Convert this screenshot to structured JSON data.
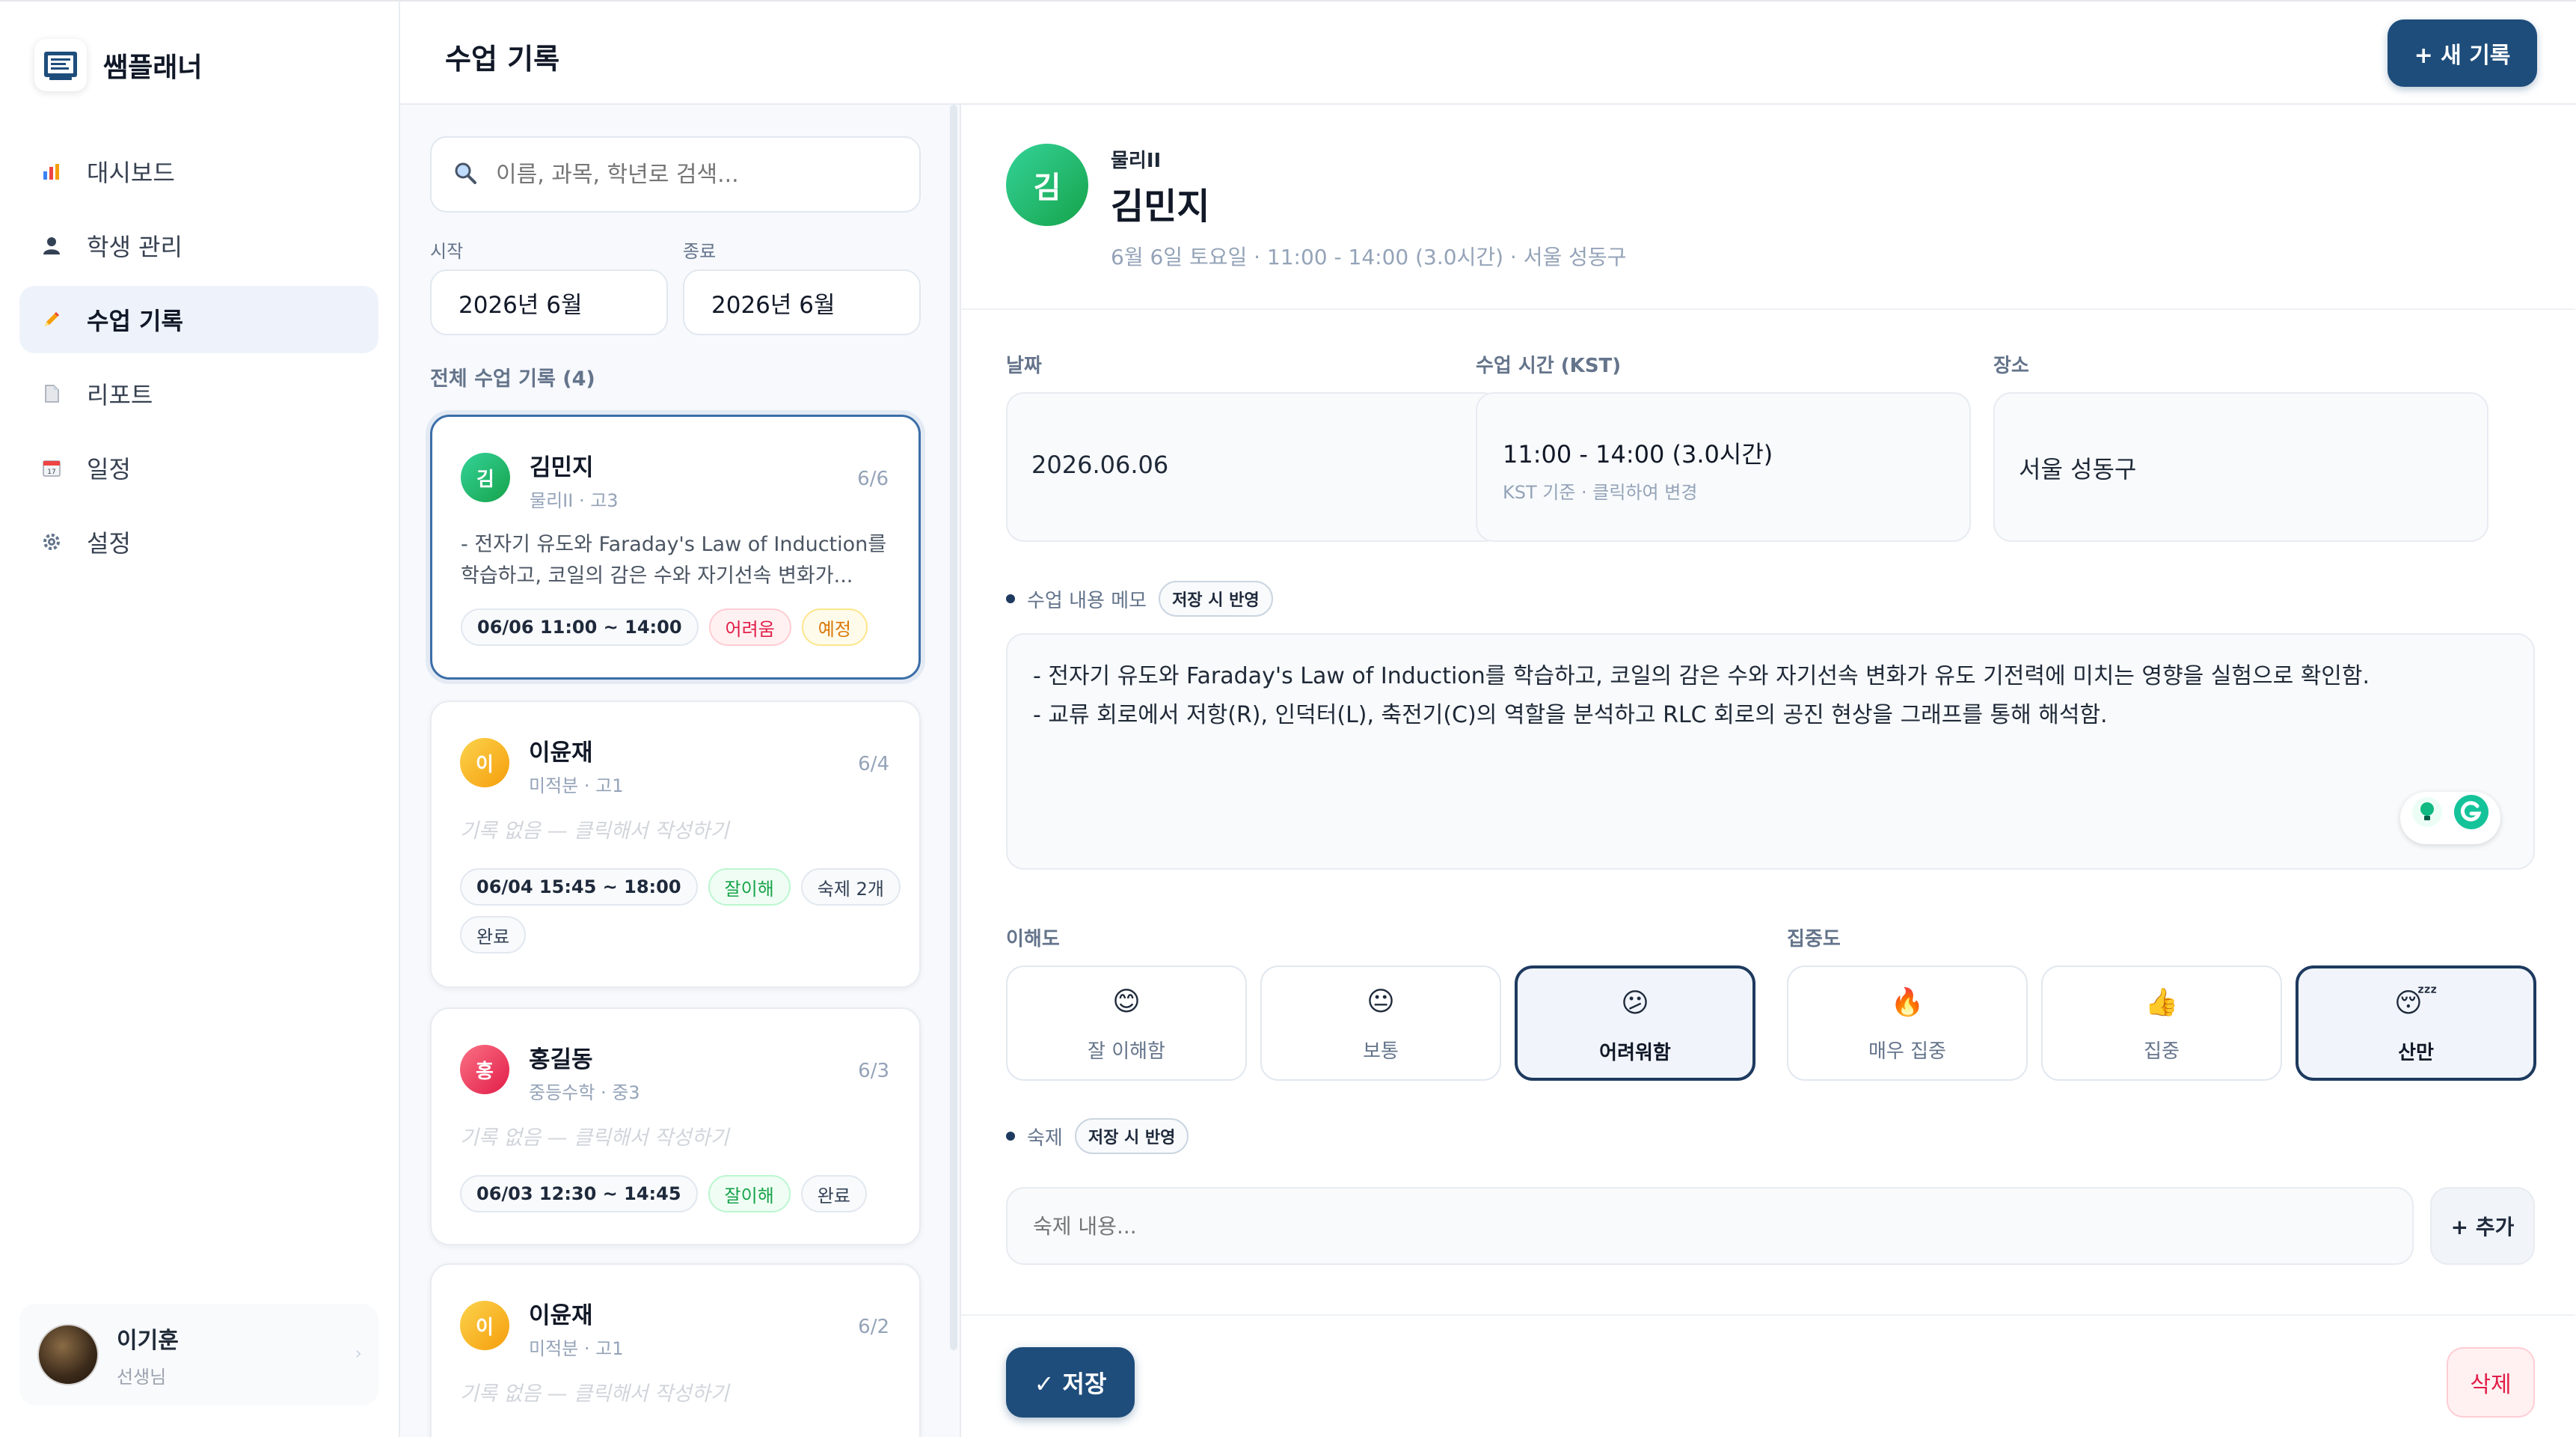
{
  "sidebar": {
    "brand": "쌤플래너",
    "items": [
      {
        "label": "대시보드",
        "icon": "chart-icon"
      },
      {
        "label": "학생 관리",
        "icon": "user-icon"
      },
      {
        "label": "수업 기록",
        "icon": "pencil-icon"
      },
      {
        "label": "리포트",
        "icon": "document-icon"
      },
      {
        "label": "일정",
        "icon": "calendar-icon"
      },
      {
        "label": "설정",
        "icon": "gear-icon"
      }
    ],
    "active_item": "수업 기록",
    "user": {
      "name": "이기훈",
      "role": "선생님"
    }
  },
  "header": {
    "title": "수업 기록",
    "new_button": "+ 새 기록"
  },
  "list": {
    "search_placeholder": "이름, 과목, 학년로 검색...",
    "start_label": "시작",
    "start_value": "2026년 6월",
    "end_label": "종료",
    "end_value": "2026년 6월",
    "count_label": "전체 수업 기록 (4)",
    "cards": [
      {
        "initial": "김",
        "avatar_color": "#22c55e",
        "name": "김민지",
        "sub": "물리II · 고3",
        "date": "6/6",
        "body": "- 전자기 유도와 Faraday's Law of Induction를 학습하고, 코일의 감은 수와 자기선속 변화가...",
        "chips": [
          {
            "text": "06/06 11:00 ~ 14:00",
            "kind": "time"
          },
          {
            "text": "어려움",
            "kind": "hard"
          },
          {
            "text": "예정",
            "kind": "plan"
          }
        ]
      },
      {
        "initial": "이",
        "avatar_color": "#f59e0b",
        "name": "이윤재",
        "sub": "미적분 · 고1",
        "date": "6/4",
        "empty": "기록 없음 — 클릭해서 작성하기",
        "chips": [
          {
            "text": "06/04 15:45 ~ 18:00",
            "kind": "time"
          },
          {
            "text": "잘이해",
            "kind": "good"
          },
          {
            "text": "숙제 2개",
            "kind": "plain"
          },
          {
            "text": "완료",
            "kind": "plain"
          }
        ]
      },
      {
        "initial": "홍",
        "avatar_color": "#f43f5e",
        "name": "홍길동",
        "sub": "중등수학 · 중3",
        "date": "6/3",
        "empty": "기록 없음 — 클릭해서 작성하기",
        "chips": [
          {
            "text": "06/03 12:30 ~ 14:45",
            "kind": "time"
          },
          {
            "text": "잘이해",
            "kind": "good"
          },
          {
            "text": "완료",
            "kind": "plain"
          }
        ]
      },
      {
        "initial": "이",
        "avatar_color": "#f59e0b",
        "name": "이윤재",
        "sub": "미적분 · 고1",
        "date": "6/2",
        "empty": "기록 없음 — 클릭해서 작성하기",
        "chips": []
      }
    ]
  },
  "detail": {
    "initial": "김",
    "subject": "물리II",
    "name": "김민지",
    "meta": "6월 6일 토요일 · 11:00 - 14:00 (3.0시간) · 서울 성동구",
    "date_label": "날짜",
    "date_value": "2026.06.06",
    "time_label": "수업 시간 (KST)",
    "time_value": "11:00 - 14:00 (3.0시간)",
    "time_hint": "KST 기준 · 클릭하여 변경",
    "place_label": "장소",
    "place_value": "서울 성동구",
    "memo_label": "수업 내용 메모",
    "memo_tag": "저장 시 반영",
    "memo_lines": [
      "- 전자기 유도와 Faraday's Law of Induction를 학습하고, 코일의 감은 수와 자기선속 변화가 유도 기전력에 미치는 영향을 실험으로 확인함.",
      "- 교류 회로에서 저항(R), 인덕터(L), 축전기(C)의 역할을 분석하고 RLC 회로의 공진 현상을 그래프를 통해 해석함."
    ],
    "understanding_label": "이해도",
    "understanding_options": [
      {
        "emoji": "😊",
        "label": "잘 이해함"
      },
      {
        "emoji": "😐",
        "label": "보통"
      },
      {
        "emoji": "😕",
        "label": "어려워함"
      }
    ],
    "understanding_selected": "어려워함",
    "focus_label": "집중도",
    "focus_options": [
      {
        "emoji": "🔥",
        "label": "매우 집중"
      },
      {
        "emoji": "👍",
        "label": "집중"
      },
      {
        "emoji": "😴",
        "label": "산만"
      }
    ],
    "focus_selected": "산만",
    "homework_label": "숙제",
    "homework_tag": "저장 시 반영",
    "homework_placeholder": "숙제 내용...",
    "homework_add": "+ 추가",
    "save_button": "✓ 저장",
    "delete_button": "삭제"
  },
  "colors": {
    "primary": "#1e4d7b",
    "active_nav_bg": "#eef3fb",
    "danger": "#e11d48",
    "success": "#16a34a",
    "warning": "#d97706"
  }
}
